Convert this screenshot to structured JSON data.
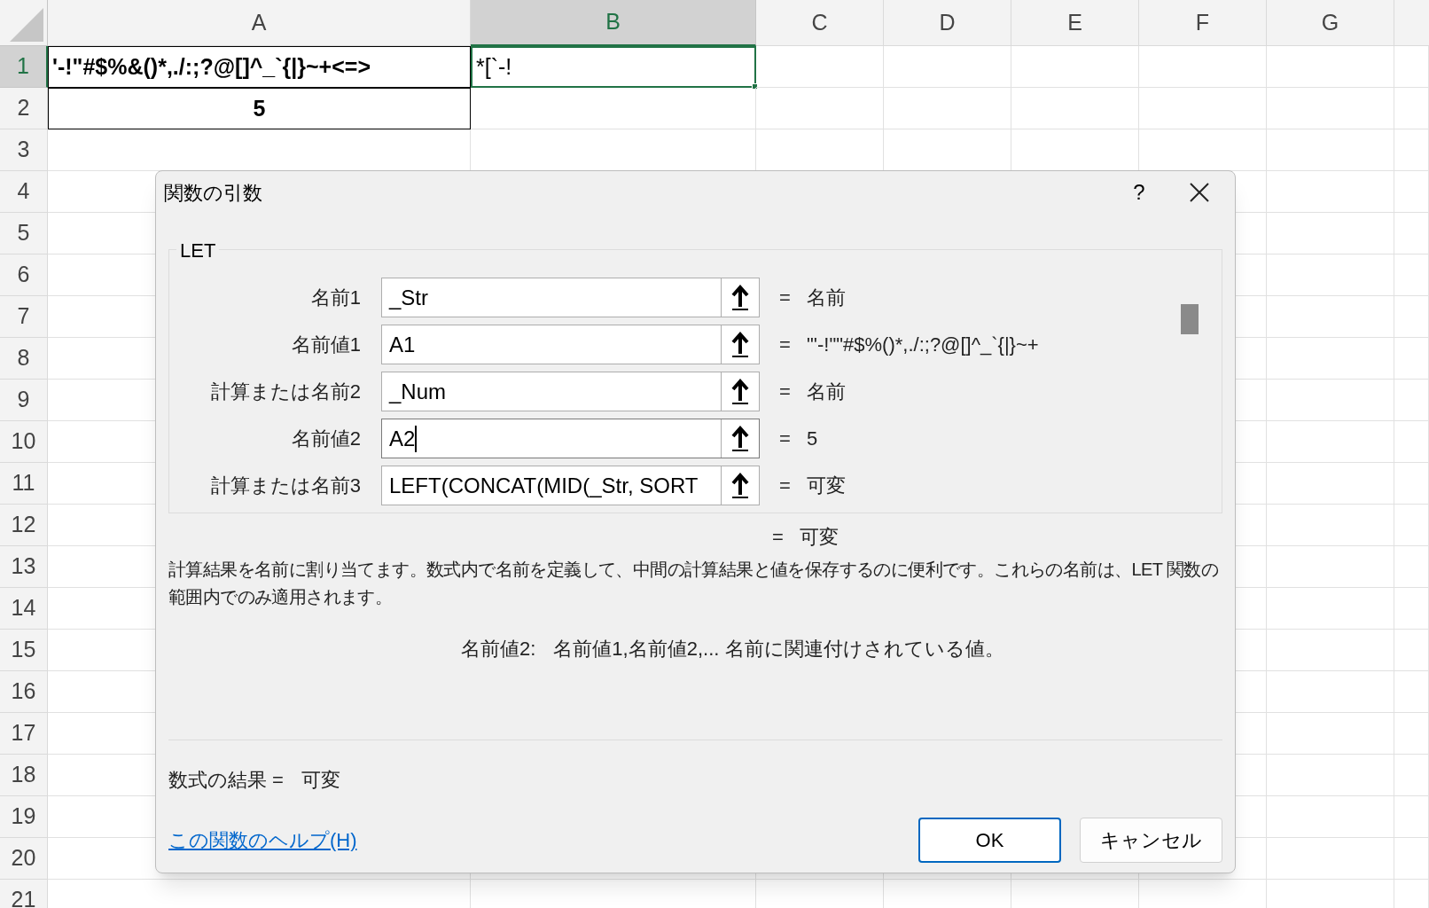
{
  "sheet": {
    "columns": [
      {
        "label": "A",
        "selected": false
      },
      {
        "label": "B",
        "selected": true
      },
      {
        "label": "C",
        "selected": false
      },
      {
        "label": "D",
        "selected": false
      },
      {
        "label": "E",
        "selected": false
      },
      {
        "label": "F",
        "selected": false
      },
      {
        "label": "G",
        "selected": false
      }
    ],
    "rows": [
      {
        "label": "1",
        "selected": true,
        "cells": [
          {
            "text": "'-!\"#$%&()*,./:;?@[]^_`{|}~+<=>",
            "bold": true,
            "centered": false,
            "bordered": true,
            "active": false
          },
          {
            "text": "*[`-!",
            "bold": false,
            "centered": false,
            "active": true
          }
        ]
      },
      {
        "label": "2",
        "selected": false,
        "cells": [
          {
            "text": "5",
            "bold": true,
            "centered": true,
            "bordered": true,
            "active": false
          }
        ]
      },
      {
        "label": "3",
        "selected": false
      },
      {
        "label": "4",
        "selected": false
      },
      {
        "label": "5",
        "selected": false
      },
      {
        "label": "6",
        "selected": false
      },
      {
        "label": "7",
        "selected": false
      },
      {
        "label": "8",
        "selected": false
      },
      {
        "label": "9",
        "selected": false
      },
      {
        "label": "10",
        "selected": false
      },
      {
        "label": "11",
        "selected": false
      },
      {
        "label": "12",
        "selected": false
      },
      {
        "label": "13",
        "selected": false
      },
      {
        "label": "14",
        "selected": false
      },
      {
        "label": "15",
        "selected": false
      },
      {
        "label": "16",
        "selected": false
      },
      {
        "label": "17",
        "selected": false
      },
      {
        "label": "18",
        "selected": false
      },
      {
        "label": "19",
        "selected": false
      },
      {
        "label": "20",
        "selected": false
      },
      {
        "label": "21",
        "selected": false
      }
    ]
  },
  "dialog": {
    "title": "関数の引数",
    "help": "?",
    "function_name": "LET",
    "arguments": [
      {
        "label": "名前1",
        "value": "_Str",
        "equals": "=",
        "result": "名前",
        "focused": false
      },
      {
        "label": "名前値1",
        "value": "A1",
        "equals": "=",
        "result": "\"'-!\"\"#$%()*,./:;?@[]^_`{|}~+",
        "focused": false
      },
      {
        "label": "計算または名前2",
        "value": "_Num",
        "equals": "=",
        "result": "名前",
        "focused": false
      },
      {
        "label": "名前値2",
        "value": "A2",
        "equals": "=",
        "result": "5",
        "focused": true
      },
      {
        "label": "計算または名前3",
        "value": "LEFT(CONCAT(MID(_Str, SORT",
        "equals": "=",
        "result": "可変",
        "focused": false
      }
    ],
    "formula_equals": "=",
    "formula_value": "可変",
    "description": "計算結果を名前に割り当てます。数式内で名前を定義して、中間の計算結果と値を保存するのに便利です。これらの名前は、LET 関数の範囲内でのみ適用されます。",
    "argument_help": {
      "name": "名前値2:",
      "text": "名前値1,名前値2,... 名前に関連付けされている値。"
    },
    "result_label": "数式の結果 =",
    "result_value": "可変",
    "help_link": "この関数のヘルプ(H)",
    "buttons": [
      {
        "label": "OK",
        "default": true
      },
      {
        "label": "キャンセル",
        "default": false
      }
    ]
  }
}
